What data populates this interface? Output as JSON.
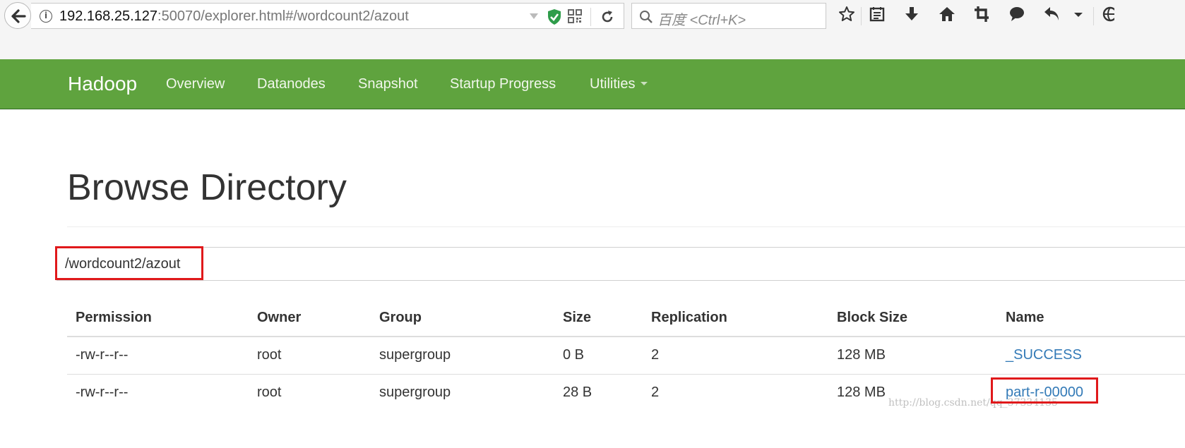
{
  "browser": {
    "url_host": "192.168.25.127",
    "url_rest": ":50070/explorer.html#/wordcount2/azout",
    "search_placeholder": "百度 <Ctrl+K>",
    "toolbar_icons": [
      "star-icon",
      "reading-list-icon",
      "download-icon",
      "home-icon",
      "crop-icon",
      "chat-icon",
      "undo-icon",
      "dropdown-icon",
      "globe-icon"
    ]
  },
  "navbar": {
    "brand": "Hadoop",
    "items": [
      "Overview",
      "Datanodes",
      "Snapshot",
      "Startup Progress",
      "Utilities"
    ],
    "accent_color": "#5fa33e"
  },
  "page": {
    "title": "Browse Directory",
    "current_path": "/wordcount2/azout",
    "highlight_color": "#e0191b"
  },
  "table": {
    "columns": [
      "Permission",
      "Owner",
      "Group",
      "Size",
      "Replication",
      "Block Size",
      "Name"
    ],
    "rows": [
      [
        "-rw-r--r--",
        "root",
        "supergroup",
        "0 B",
        "2",
        "128 MB",
        "_SUCCESS"
      ],
      [
        "-rw-r--r--",
        "root",
        "supergroup",
        "28 B",
        "2",
        "128 MB",
        "part-r-00000"
      ]
    ]
  },
  "watermark": "http://blog.csdn.net/qq_37334135"
}
